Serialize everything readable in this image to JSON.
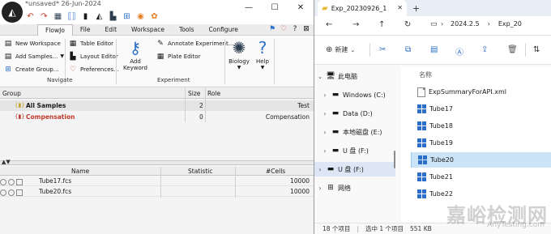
{
  "flowjo": {
    "title": "*unsaved* 26-Jun-2024",
    "window_controls": [
      "—",
      "☐",
      "✕"
    ],
    "menu": [
      "FlowJo",
      "File",
      "Edit",
      "Workspace",
      "Tools",
      "Configure"
    ],
    "menu_active": "FlowJo",
    "ribbon": {
      "new_workspace": "New Workspace",
      "add_samples": "Add Samples...",
      "create_group": "Create Group...",
      "table_editor": "Table Editor",
      "layout_editor": "Layout Editor",
      "preferences": "Preferences...",
      "add_keyword_1": "Add",
      "add_keyword_2": "Keyword",
      "annotate_experiment": "Annotate Experiment...",
      "plate_editor": "Plate Editor",
      "biology": "Biology",
      "help": "Help",
      "group_navigate": "Navigate",
      "group_experiment": "Experiment"
    },
    "groups_table": {
      "headers": [
        "Group",
        "Size",
        "Role"
      ],
      "rows": [
        {
          "name": "All Samples",
          "size": "2",
          "role": "Test",
          "color": "#1a1a1a"
        },
        {
          "name": "Compensation",
          "size": "0",
          "role": "Compensation",
          "color": "#c0392b"
        }
      ]
    },
    "samples_table": {
      "headers": [
        "Name",
        "Statistic",
        "#Cells"
      ],
      "rows": [
        {
          "name": "Tube17.fcs",
          "statistic": "",
          "cells": "10000"
        },
        {
          "name": "Tube20.fcs",
          "statistic": "",
          "cells": "10000"
        }
      ]
    }
  },
  "explorer": {
    "tab_title": "Exp_20230926_1",
    "path": [
      "2024.2.5",
      "›",
      "Exp_20"
    ],
    "new_button": "新建",
    "tree": [
      {
        "label": "此电脑",
        "chevron": "⌄",
        "icon": "🖥",
        "indent": 0
      },
      {
        "label": "Windows (C:)",
        "chevron": "›",
        "icon": "▬",
        "indent": 1
      },
      {
        "label": "Data (D:)",
        "chevron": "›",
        "icon": "▬",
        "indent": 1
      },
      {
        "label": "本地磁盘 (E:)",
        "chevron": "›",
        "icon": "▬",
        "indent": 1
      },
      {
        "label": "U 盘 (F:)",
        "chevron": "›",
        "icon": "▬",
        "indent": 1
      },
      {
        "label": "U 盘 (F:)",
        "chevron": "›",
        "icon": "▬",
        "indent": 0
      },
      {
        "label": "网络",
        "chevron": "›",
        "icon": "⊞",
        "indent": 0
      }
    ],
    "tree_selected": 5,
    "column_name": "名称",
    "files": [
      {
        "name": "ExpSummaryForAPI.xml",
        "type": "xml"
      },
      {
        "name": "Tube17",
        "type": "fcs"
      },
      {
        "name": "Tube18",
        "type": "fcs"
      },
      {
        "name": "Tube19",
        "type": "fcs"
      },
      {
        "name": "Tube20",
        "type": "fcs"
      },
      {
        "name": "Tube21",
        "type": "fcs"
      },
      {
        "name": "Tube22",
        "type": "fcs"
      }
    ],
    "file_selected": 4,
    "status": {
      "items": "18 个项目",
      "selected": "选中 1 个项目",
      "size": "551 KB"
    },
    "watermark": "嘉峪检测网",
    "watermark_sub": "AnyTesting.com"
  }
}
